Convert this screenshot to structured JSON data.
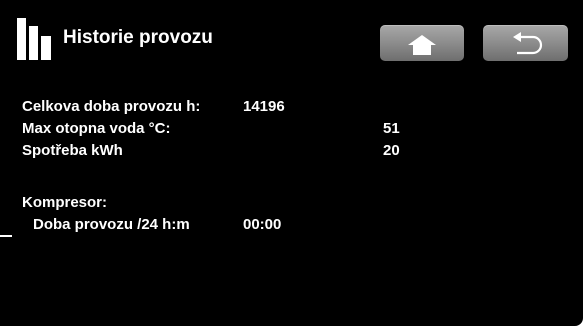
{
  "header": {
    "title": "Historie provozu",
    "home_button": "home-icon",
    "back_button": "return-arrow-icon",
    "button_color": "#8f8f8f"
  },
  "stats": {
    "total_runtime": {
      "label": "Celkova doba provozu h:",
      "value": "14196"
    },
    "max_heating_water": {
      "label": "Max otopna voda °C:",
      "value": "51"
    },
    "consumption": {
      "label": "Spotřeba kWh",
      "value": "20"
    }
  },
  "compressor": {
    "heading": "Kompresor:",
    "runtime_24h": {
      "label": "Doba provozu /24 h:m",
      "value": "00:00"
    }
  }
}
